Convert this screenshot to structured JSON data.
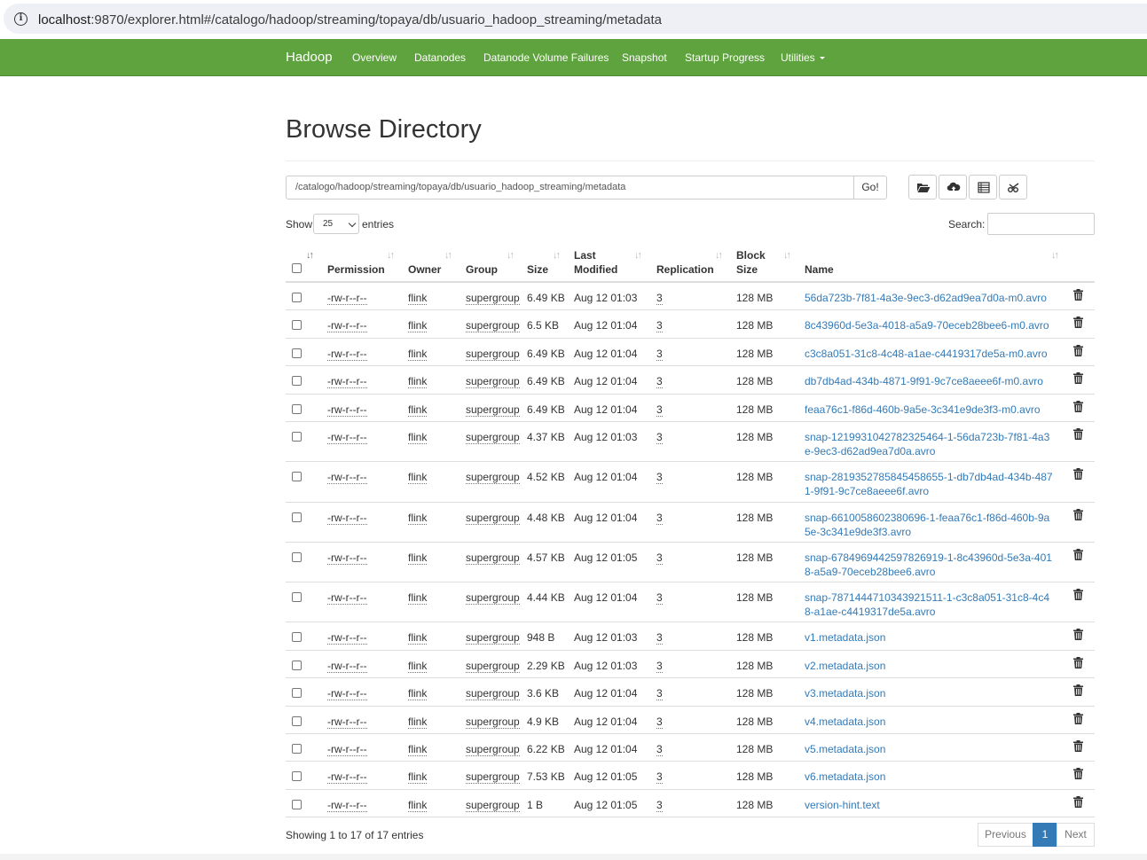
{
  "browser": {
    "url_host": "localhost",
    "url_rest": ":9870/explorer.html#/catalogo/hadoop/streaming/topaya/db/usuario_hadoop_streaming/metadata"
  },
  "navbar": {
    "brand": "Hadoop",
    "items": [
      "Overview",
      "Datanodes",
      "Datanode Volume Failures",
      "Snapshot",
      "Startup Progress",
      "Utilities"
    ],
    "color": "#5fa33e"
  },
  "page": {
    "title": "Browse Directory",
    "path_value": "/catalogo/hadoop/streaming/topaya/db/usuario_hadoop_streaming/metadata",
    "go_label": "Go!",
    "show_label": "Show",
    "entries_value": "25",
    "entries_label": "entries",
    "search_label": "Search:",
    "toolbar_icons": [
      "folder-open-icon",
      "cloud-upload-icon",
      "list-icon",
      "cut-icon"
    ]
  },
  "table": {
    "headers": {
      "permission": "Permission",
      "owner": "Owner",
      "group": "Group",
      "size": "Size",
      "last_modified_1": "Last",
      "last_modified_2": "Modified",
      "replication": "Replication",
      "block_size_1": "Block",
      "block_size_2": "Size",
      "name": "Name"
    },
    "rows": [
      {
        "permission": "-rw-r--r--",
        "owner": "flink",
        "group": "supergroup",
        "size": "6.49 KB",
        "modified": "Aug 12 01:03",
        "replication": "3",
        "block": "128 MB",
        "name": "56da723b-7f81-4a3e-9ec3-d62ad9ea7d0a-m0.avro",
        "tall": false
      },
      {
        "permission": "-rw-r--r--",
        "owner": "flink",
        "group": "supergroup",
        "size": "6.5 KB",
        "modified": "Aug 12 01:04",
        "replication": "3",
        "block": "128 MB",
        "name": "8c43960d-5e3a-4018-a5a9-70eceb28bee6-m0.avro",
        "tall": false
      },
      {
        "permission": "-rw-r--r--",
        "owner": "flink",
        "group": "supergroup",
        "size": "6.49 KB",
        "modified": "Aug 12 01:04",
        "replication": "3",
        "block": "128 MB",
        "name": "c3c8a051-31c8-4c48-a1ae-c4419317de5a-m0.avro",
        "tall": false
      },
      {
        "permission": "-rw-r--r--",
        "owner": "flink",
        "group": "supergroup",
        "size": "6.49 KB",
        "modified": "Aug 12 01:04",
        "replication": "3",
        "block": "128 MB",
        "name": "db7db4ad-434b-4871-9f91-9c7ce8aeee6f-m0.avro",
        "tall": false
      },
      {
        "permission": "-rw-r--r--",
        "owner": "flink",
        "group": "supergroup",
        "size": "6.49 KB",
        "modified": "Aug 12 01:04",
        "replication": "3",
        "block": "128 MB",
        "name": "feaa76c1-f86d-460b-9a5e-3c341e9de3f3-m0.avro",
        "tall": false
      },
      {
        "permission": "-rw-r--r--",
        "owner": "flink",
        "group": "supergroup",
        "size": "4.37 KB",
        "modified": "Aug 12 01:03",
        "replication": "3",
        "block": "128 MB",
        "name": "snap-1219931042782325464-1-56da723b-7f81-4a3e-9ec3-d62ad9ea7d0a.avro",
        "tall": true
      },
      {
        "permission": "-rw-r--r--",
        "owner": "flink",
        "group": "supergroup",
        "size": "4.52 KB",
        "modified": "Aug 12 01:04",
        "replication": "3",
        "block": "128 MB",
        "name": "snap-2819352785845458655-1-db7db4ad-434b-4871-9f91-9c7ce8aeee6f.avro",
        "tall": true
      },
      {
        "permission": "-rw-r--r--",
        "owner": "flink",
        "group": "supergroup",
        "size": "4.48 KB",
        "modified": "Aug 12 01:04",
        "replication": "3",
        "block": "128 MB",
        "name": "snap-6610058602380696-1-feaa76c1-f86d-460b-9a5e-3c341e9de3f3.avro",
        "tall": true
      },
      {
        "permission": "-rw-r--r--",
        "owner": "flink",
        "group": "supergroup",
        "size": "4.57 KB",
        "modified": "Aug 12 01:05",
        "replication": "3",
        "block": "128 MB",
        "name": "snap-6784969442597826919-1-8c43960d-5e3a-4018-a5a9-70eceb28bee6.avro",
        "tall": true
      },
      {
        "permission": "-rw-r--r--",
        "owner": "flink",
        "group": "supergroup",
        "size": "4.44 KB",
        "modified": "Aug 12 01:04",
        "replication": "3",
        "block": "128 MB",
        "name": "snap-7871444710343921511-1-c3c8a051-31c8-4c48-a1ae-c4419317de5a.avro",
        "tall": true
      },
      {
        "permission": "-rw-r--r--",
        "owner": "flink",
        "group": "supergroup",
        "size": "948 B",
        "modified": "Aug 12 01:03",
        "replication": "3",
        "block": "128 MB",
        "name": "v1.metadata.json",
        "tall": false
      },
      {
        "permission": "-rw-r--r--",
        "owner": "flink",
        "group": "supergroup",
        "size": "2.29 KB",
        "modified": "Aug 12 01:03",
        "replication": "3",
        "block": "128 MB",
        "name": "v2.metadata.json",
        "tall": false
      },
      {
        "permission": "-rw-r--r--",
        "owner": "flink",
        "group": "supergroup",
        "size": "3.6 KB",
        "modified": "Aug 12 01:04",
        "replication": "3",
        "block": "128 MB",
        "name": "v3.metadata.json",
        "tall": false
      },
      {
        "permission": "-rw-r--r--",
        "owner": "flink",
        "group": "supergroup",
        "size": "4.9 KB",
        "modified": "Aug 12 01:04",
        "replication": "3",
        "block": "128 MB",
        "name": "v4.metadata.json",
        "tall": false
      },
      {
        "permission": "-rw-r--r--",
        "owner": "flink",
        "group": "supergroup",
        "size": "6.22 KB",
        "modified": "Aug 12 01:04",
        "replication": "3",
        "block": "128 MB",
        "name": "v5.metadata.json",
        "tall": false
      },
      {
        "permission": "-rw-r--r--",
        "owner": "flink",
        "group": "supergroup",
        "size": "7.53 KB",
        "modified": "Aug 12 01:05",
        "replication": "3",
        "block": "128 MB",
        "name": "v6.metadata.json",
        "tall": false
      },
      {
        "permission": "-rw-r--r--",
        "owner": "flink",
        "group": "supergroup",
        "size": "1 B",
        "modified": "Aug 12 01:05",
        "replication": "3",
        "block": "128 MB",
        "name": "version-hint.text",
        "tall": false
      }
    ]
  },
  "footer": {
    "info": "Showing 1 to 17 of 17 entries",
    "previous": "Previous",
    "page": "1",
    "next": "Next"
  }
}
